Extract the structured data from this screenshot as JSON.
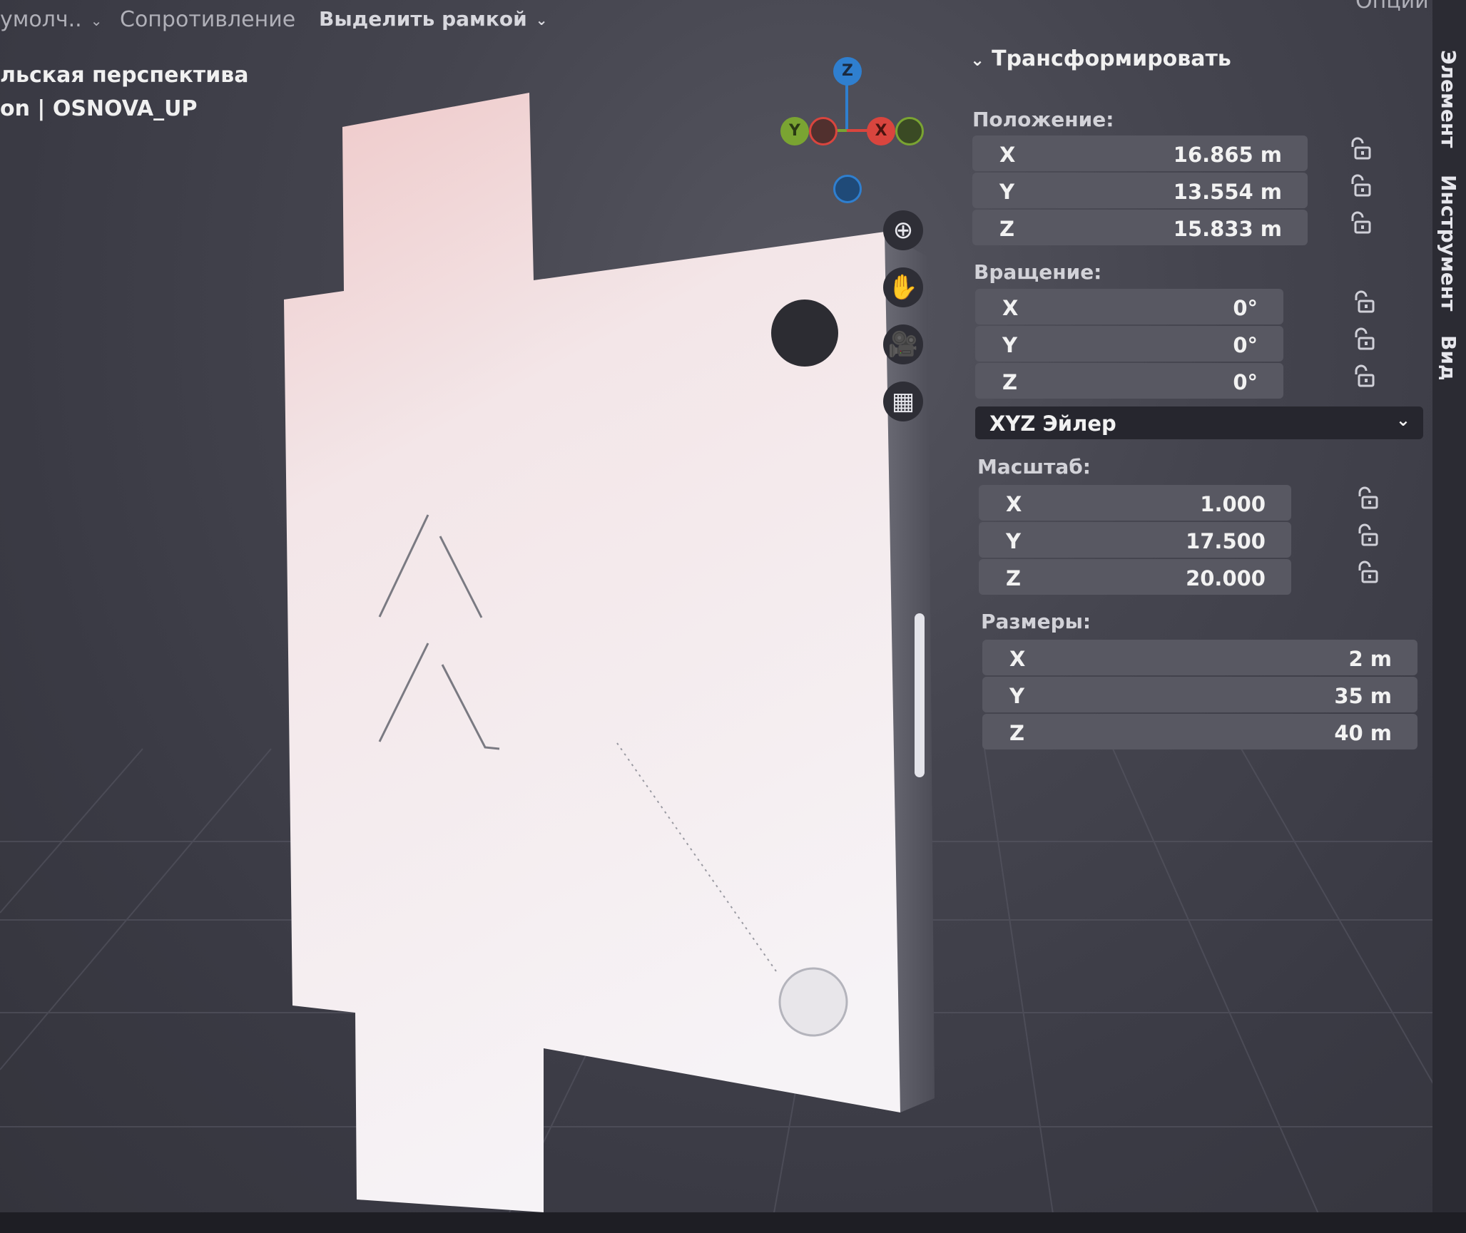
{
  "header": {
    "mode_label": "умолч..",
    "snap_label": "Сопротивление",
    "select_label": "Выделить рамкой",
    "options_label": "Опции"
  },
  "overlay": {
    "view_name": "льская перспектива",
    "object_info": "on | OSNOVA_UP"
  },
  "gizmo": {
    "z_label": "Z",
    "y_label": "Y",
    "x_label": "X",
    "colors": {
      "x": "#d9453e",
      "y": "#7aa432",
      "z": "#2f7fcf"
    }
  },
  "nav_icons": [
    "zoom-icon",
    "hand-pan-icon",
    "camera-icon",
    "grid-icon"
  ],
  "panel": {
    "title": "Трансформировать",
    "location": {
      "label": "Положение:",
      "x": {
        "axis": "X",
        "value": "16.865 m"
      },
      "y": {
        "axis": "Y",
        "value": "13.554 m"
      },
      "z": {
        "axis": "Z",
        "value": "15.833 m"
      }
    },
    "rotation": {
      "label": "Вращение:",
      "x": {
        "axis": "X",
        "value": "0°"
      },
      "y": {
        "axis": "Y",
        "value": "0°"
      },
      "z": {
        "axis": "Z",
        "value": "0°"
      },
      "mode": "XYZ Эйлер"
    },
    "scale": {
      "label": "Масштаб:",
      "x": {
        "axis": "X",
        "value": "1.000"
      },
      "y": {
        "axis": "Y",
        "value": "17.500"
      },
      "z": {
        "axis": "Z",
        "value": "20.000"
      }
    },
    "dimensions": {
      "label": "Размеры:",
      "x": {
        "axis": "X",
        "value": "2 m"
      },
      "y": {
        "axis": "Y",
        "value": "35 m"
      },
      "z": {
        "axis": "Z",
        "value": "40 m"
      }
    }
  },
  "tabs": {
    "item": "Элемент",
    "tool": "Инструмент",
    "view": "Вид"
  }
}
